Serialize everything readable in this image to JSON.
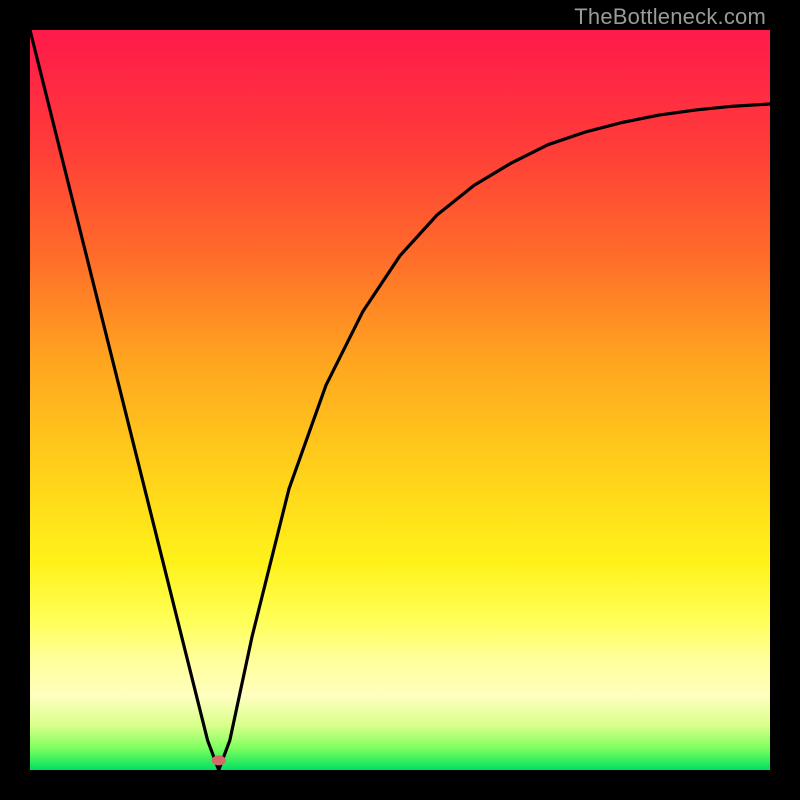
{
  "watermark": {
    "text": "TheBottleneck.com"
  },
  "colors": {
    "frame": "#000000",
    "gradient_top": "#ff1a4b",
    "gradient_bottom": "#00e060",
    "curve": "#000000",
    "marker": "#d46a6a"
  },
  "chart_data": {
    "type": "line",
    "title": "",
    "xlabel": "",
    "ylabel": "",
    "xlim": [
      0,
      1
    ],
    "ylim": [
      0,
      1
    ],
    "annotations": [
      {
        "label": "marker",
        "x": 0.255,
        "y": 0.013
      }
    ],
    "series": [
      {
        "name": "curve",
        "x": [
          0.0,
          0.05,
          0.1,
          0.15,
          0.2,
          0.24,
          0.255,
          0.27,
          0.3,
          0.35,
          0.4,
          0.45,
          0.5,
          0.55,
          0.6,
          0.65,
          0.7,
          0.75,
          0.8,
          0.85,
          0.9,
          0.95,
          1.0
        ],
        "y": [
          1.0,
          0.8,
          0.6,
          0.4,
          0.2,
          0.04,
          0.0,
          0.04,
          0.18,
          0.38,
          0.52,
          0.62,
          0.695,
          0.75,
          0.79,
          0.82,
          0.845,
          0.862,
          0.875,
          0.885,
          0.892,
          0.897,
          0.9
        ]
      }
    ]
  }
}
